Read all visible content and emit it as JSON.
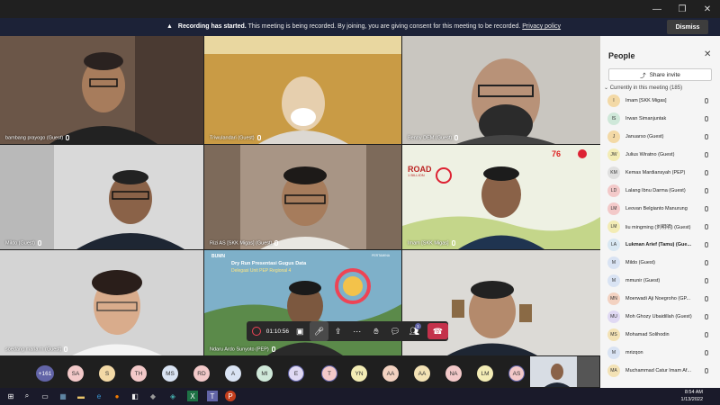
{
  "window": {
    "minimize": "—",
    "restore": "❐",
    "close": "✕"
  },
  "banner": {
    "title": "Recording has started.",
    "message": "This meeting is being recorded. By joining, you are giving consent for this meeting to be recorded.",
    "link": "Privacy policy",
    "dismiss": "Dismiss"
  },
  "tiles": [
    {
      "name": "bambang prayogo (Guest)"
    },
    {
      "name": "Triwulandari (Guest)"
    },
    {
      "name": "Benny DEM (Guest)"
    },
    {
      "name": "Mildo (Guest)"
    },
    {
      "name": "Rizi AS [SKK Migas] (Guest)"
    },
    {
      "name": "Imam [SKK Migas]"
    },
    {
      "name": "soedang maria m (Guest)"
    },
    {
      "name": "Ndaru Ardo Sunyoto (PEP)"
    },
    {
      "name": ""
    }
  ],
  "slides": {
    "road": "ROAD",
    "billion": "1 BILLION",
    "bumn": "BUMN",
    "pertamina": "PERTAMINA",
    "dry_run": "Dry Run Presentasi Gugus Data",
    "delegasi": "Delegasi Unit PEP Regional 4",
    "num76": "76"
  },
  "controls": {
    "timer": "01:10:56",
    "people_count": "1"
  },
  "strip": {
    "overflow": "+161",
    "avatars": [
      "SA",
      "S",
      "TH",
      "MS",
      "RD",
      "A",
      "MI",
      "E",
      "T",
      "YN",
      "AA",
      "AA",
      "NA",
      "LM",
      "AS"
    ]
  },
  "panel": {
    "title": "People",
    "share": "Share invite",
    "in_meeting": "Currently in this meeting (185)",
    "people": [
      {
        "initials": "I",
        "name": "Imam [SKK Migas]",
        "color": "#f3d9a6"
      },
      {
        "initials": "IS",
        "name": "Irwan Simanjuntak",
        "color": "#cfe8d9"
      },
      {
        "initials": "J",
        "name": "Januarso (Guest)",
        "color": "#f3d9a6"
      },
      {
        "initials": "JW",
        "name": "Julius Wiratno (Guest)",
        "color": "#f3ecb5"
      },
      {
        "initials": "KM",
        "name": "Kemas Mardiansyah (PEP)",
        "color": "#e0e0e0"
      },
      {
        "initials": "LD",
        "name": "Lalang Ibnu Darma (Guest)",
        "color": "#f3c9c9"
      },
      {
        "initials": "LM",
        "name": "Leovan Belgianto Manurung",
        "color": "#f3c9c9"
      },
      {
        "initials": "LM",
        "name": "liu mingming (刘明明) (Guest)",
        "color": "#f3ecb5"
      },
      {
        "initials": "LA",
        "name": "Lukman Arief (Tamu) (Gue...",
        "color": "#d9e8f3"
      },
      {
        "initials": "M",
        "name": "Mildo (Guest)",
        "color": "#d9e3f3"
      },
      {
        "initials": "M",
        "name": "mmunir (Guest)",
        "color": "#d9e3f3"
      },
      {
        "initials": "MN",
        "name": "Moerwadi Aji Noegroho (GP...",
        "color": "#f3d2c1"
      },
      {
        "initials": "MU",
        "name": "Moh Ghozy Ubaidillah (Guest)",
        "color": "#e0d9f3"
      },
      {
        "initials": "MS",
        "name": "Mohamad Solihodin",
        "color": "#f3e2b5"
      },
      {
        "initials": "M",
        "name": "mrizqon",
        "color": "#d9e3f3"
      },
      {
        "initials": "MA",
        "name": "Muchammad Catur Imam Af...",
        "color": "#f3e2b5"
      }
    ]
  },
  "taskbar": {
    "time": "8:54 AM",
    "date": "1/13/2022"
  },
  "colors": {
    "accent": "#6264a7",
    "hangup": "#c4314b",
    "banner": "#1c2237",
    "panel": "#f5f5f5"
  }
}
